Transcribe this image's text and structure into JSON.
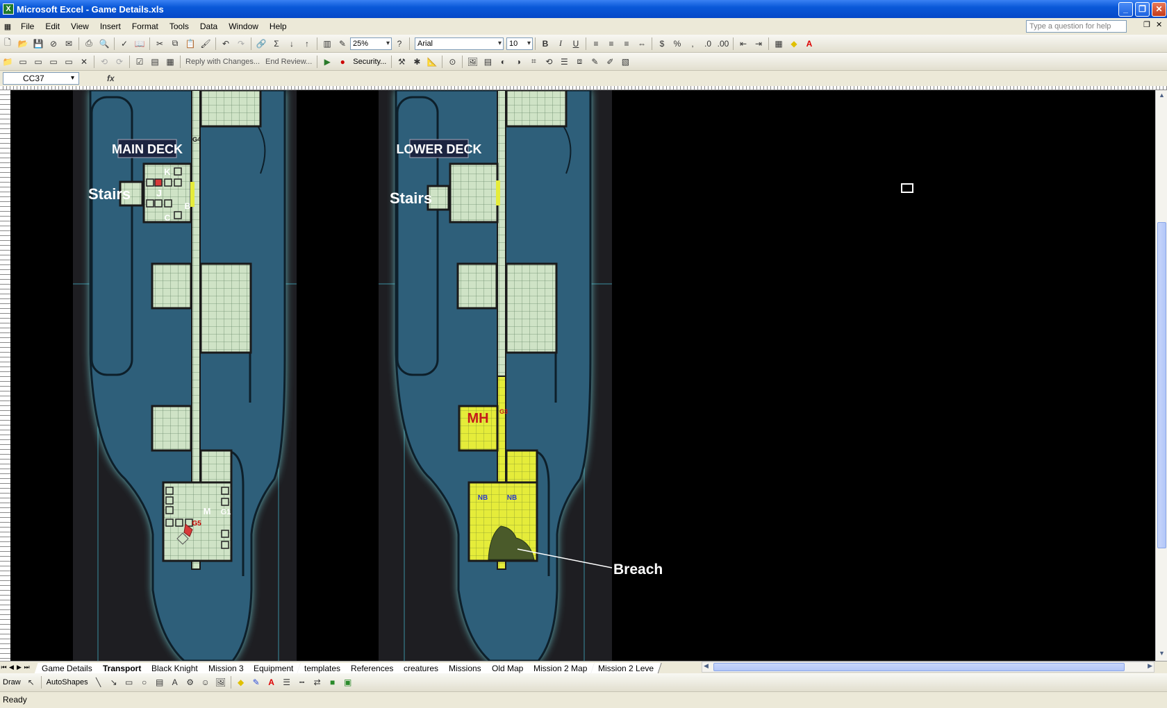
{
  "window": {
    "title": "Microsoft Excel - Game Details.xls",
    "app_icon": "excel-icon"
  },
  "menu": {
    "items": [
      "File",
      "Edit",
      "View",
      "Insert",
      "Format",
      "Tools",
      "Data",
      "Window",
      "Help"
    ],
    "help_placeholder": "Type a question for help"
  },
  "toolbar": {
    "zoom": "25%",
    "font": "Arial",
    "font_size": "10",
    "bold": "B",
    "italic": "I",
    "underline": "U",
    "reply_label": "Reply with Changes...",
    "end_review_label": "End Review...",
    "security_label": "Security...",
    "percent": "%",
    "comma": ","
  },
  "formula": {
    "cell_ref": "CC37",
    "fx": "fx"
  },
  "map": {
    "main_deck_label": "MAIN DECK",
    "lower_deck_label": "LOWER DECK",
    "stairs_left": "Stairs",
    "stairs_right": "Stairs",
    "breach_label": "Breach",
    "main_markers": {
      "k": "K",
      "j": "J",
      "b": "B",
      "c": "C",
      "m": "M",
      "g1": "G1",
      "g4": "G4",
      "g5": "G5"
    },
    "lower_markers": {
      "mh": "MH",
      "nb1": "NB",
      "nb2": "NB",
      "g3": "G3"
    }
  },
  "sheet_tabs": [
    "Game Details",
    "Transport",
    "Black Knight",
    "Mission 3",
    "Equipment",
    "templates",
    "References",
    "creatures",
    "Missions",
    "Old Map",
    "Mission 2 Map",
    "Mission 2 Leve"
  ],
  "active_tab": "Transport",
  "drawing": {
    "draw_label": "Draw",
    "autoshapes_label": "AutoShapes"
  },
  "status": {
    "text": "Ready"
  },
  "colors": {
    "hull": "#2e5f7a",
    "room": "#cfe3c6",
    "yellow": "#e5ec3a",
    "glow": "#7fe8f0"
  }
}
